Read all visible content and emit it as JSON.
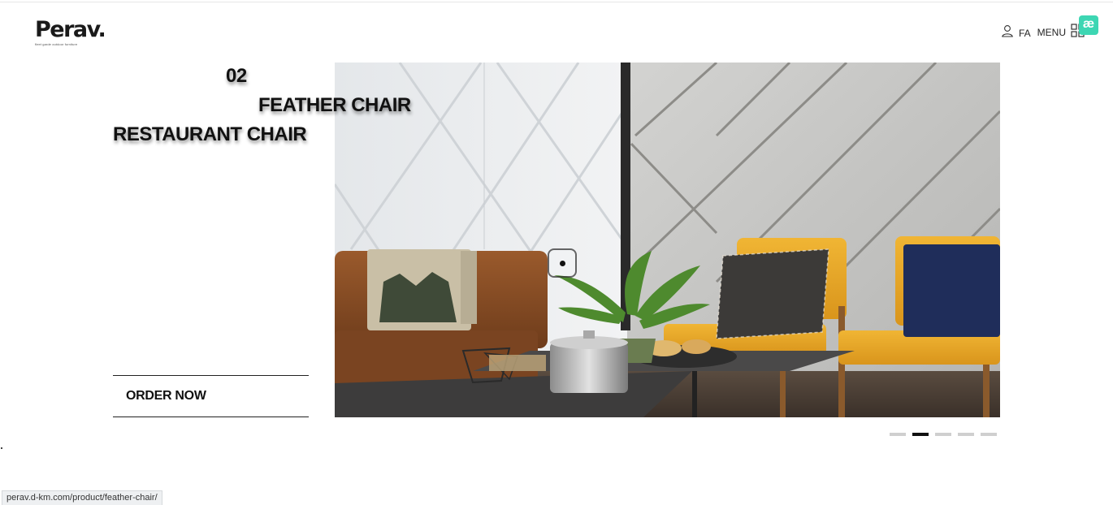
{
  "header": {
    "logo_text": "Perav.",
    "logo_tagline": "fleet garde outdoor furniture",
    "lang_label": "FA",
    "menu_label": "MENU",
    "ext_badge": "æ"
  },
  "slide": {
    "number": "02",
    "title": "FEATHER CHAIR",
    "subtitle": "RESTAURANT CHAIR",
    "cta_label": "ORDER NOW",
    "active_index": 1,
    "total_slides": 5
  },
  "icons": {
    "user": "user-icon",
    "menu_grid": "grid-icon",
    "cursor": "cursor-icon"
  },
  "colors": {
    "accent_chair": "#e8a72a",
    "badge": "#3dd6b3",
    "text": "#111111",
    "pager_inactive": "#cfcfcf",
    "pager_active": "#111111"
  },
  "status_bar": {
    "url": "perav.d-km.com/product/feather-chair/"
  }
}
